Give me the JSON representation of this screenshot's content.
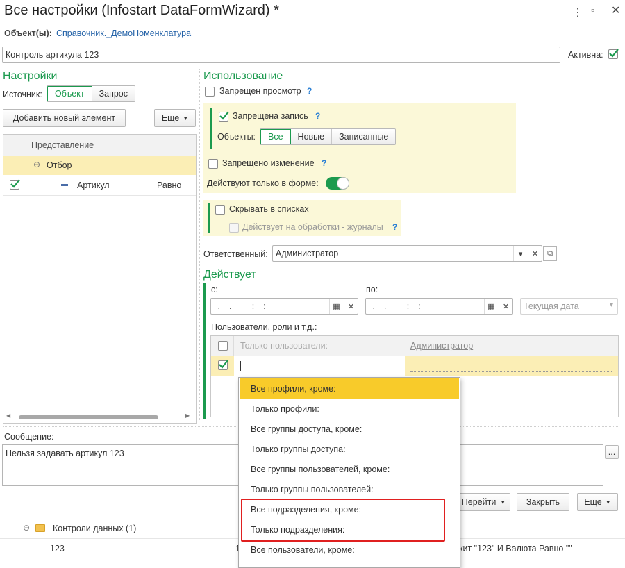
{
  "window": {
    "title": "Все настройки (Infostart DataFormWizard) *"
  },
  "objects": {
    "label": "Объект(ы):",
    "value": "Справочник._ДемоНоменклатура"
  },
  "name_field": {
    "value": "Контроль артикула 123"
  },
  "active": {
    "label": "Активна:",
    "checked": true
  },
  "settings": {
    "heading": "Настройки",
    "source_label": "Источник:",
    "source_options": [
      "Объект",
      "Запрос"
    ],
    "source_selected": "Объект",
    "add_button": "Добавить новый элемент",
    "more_button": "Еще",
    "tree": {
      "column": "Представление",
      "rows": [
        {
          "label": "Отбор",
          "kind": "group"
        },
        {
          "label": "Артикул",
          "condition": "Равно",
          "checked": true
        }
      ]
    }
  },
  "usage": {
    "heading": "Использование",
    "view_forbidden": "Запрещен просмотр",
    "write_forbidden": "Запрещена запись",
    "objects_label": "Объекты:",
    "objects_options": [
      "Все",
      "Новые",
      "Записанные"
    ],
    "objects_selected": "Все",
    "change_forbidden": "Запрещено изменение",
    "form_only": "Действуют только в форме:",
    "hide_in_lists": "Скрывать в списках",
    "applies_to_journals": "Действует на обработки - журналы"
  },
  "responsible": {
    "label": "Ответственный:",
    "value": "Администратор"
  },
  "acts": {
    "heading": "Действует",
    "from_label": "с:",
    "to_label": "по:",
    "date_placeholder": " .  .     :  :",
    "current_date": "Текущая дата",
    "users_label": "Пользователи, роли и т.д.:",
    "users_table": {
      "col_only_users": "Только пользователи:",
      "col_admin": "Администратор"
    }
  },
  "dropdown": {
    "items": [
      "Все профили, кроме:",
      "Только профили:",
      "Все группы доступа, кроме:",
      "Только группы доступа:",
      "Все группы пользователей, кроме:",
      "Только группы пользователей:",
      "Все подразделения, кроме:",
      "Только подразделения:",
      "Все пользователи, кроме:"
    ],
    "highlighted_index": 0
  },
  "message": {
    "label": "Сообщение:",
    "value": "Нельзя задавать артикул 123",
    "more": "..."
  },
  "bottom_buttons": {
    "goto": "Перейти",
    "close": "Закрыть",
    "more": "Еще"
  },
  "bottom_list": {
    "group": "Контроли данных (1)",
    "row_name": "123",
    "row_marker": "1",
    "row_condition": "кит \"123\" И Валюта Равно \"\""
  },
  "colors": {
    "accent_green": "#1b9a4e",
    "highlight_yellow": "#f8cb2a",
    "panel_yellow": "#fbf8d8",
    "outline_red": "#e02020"
  }
}
